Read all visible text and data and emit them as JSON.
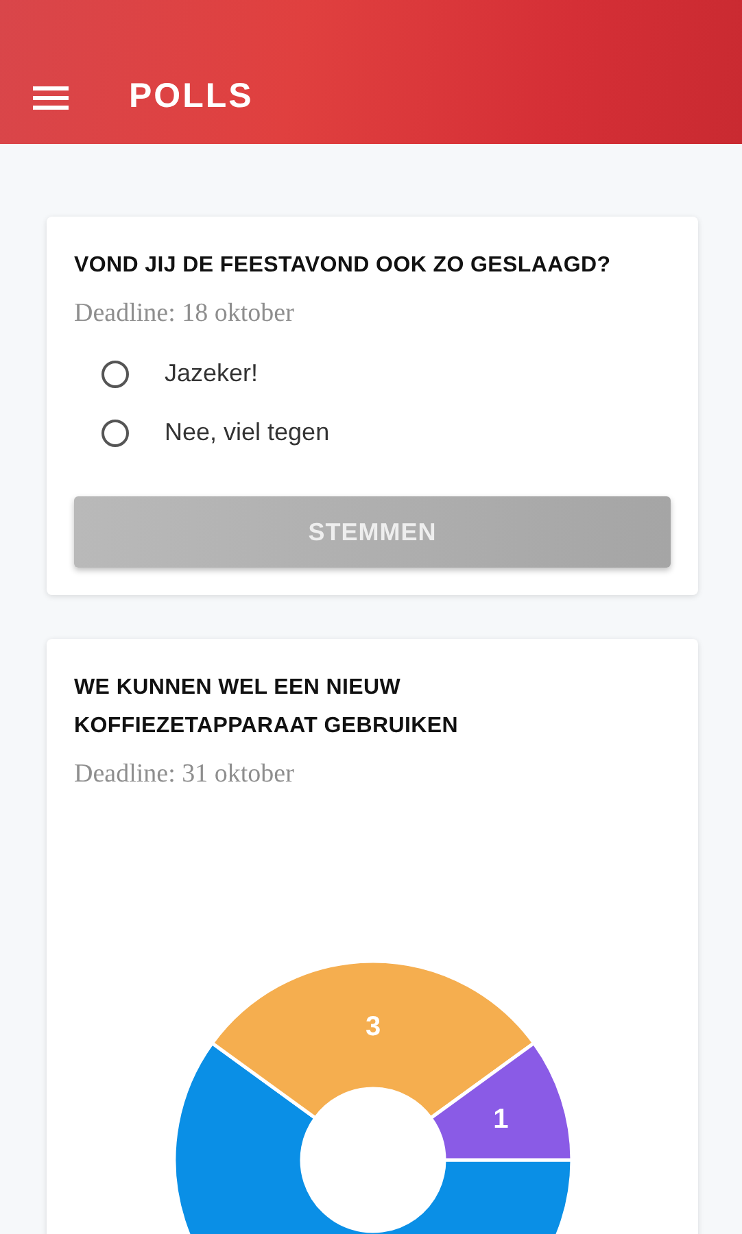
{
  "app_bar": {
    "title": "POLLS"
  },
  "polls": [
    {
      "kind": "vote",
      "question": "VOND JIJ DE FEESTAVOND OOK ZO GESLAAGD?",
      "deadline": "Deadline: 18 oktober",
      "options": [
        {
          "label": "Jazeker!",
          "selected": false
        },
        {
          "label": "Nee, viel tegen",
          "selected": false
        }
      ],
      "button": {
        "label": "STEMMEN",
        "disabled": true
      }
    },
    {
      "kind": "result",
      "question": "WE KUNNEN WEL EEN NIEUW KOFFIEZETAPPARAAT GEBRUIKEN",
      "deadline": "Deadline: 31 oktober",
      "chart_data": {
        "type": "donut",
        "values": [
          6,
          3,
          1
        ],
        "colors": [
          "#0a8fe6",
          "#f5ae4f",
          "#8a5be6"
        ],
        "value_labels": [
          null,
          "3",
          "1"
        ]
      }
    }
  ]
}
